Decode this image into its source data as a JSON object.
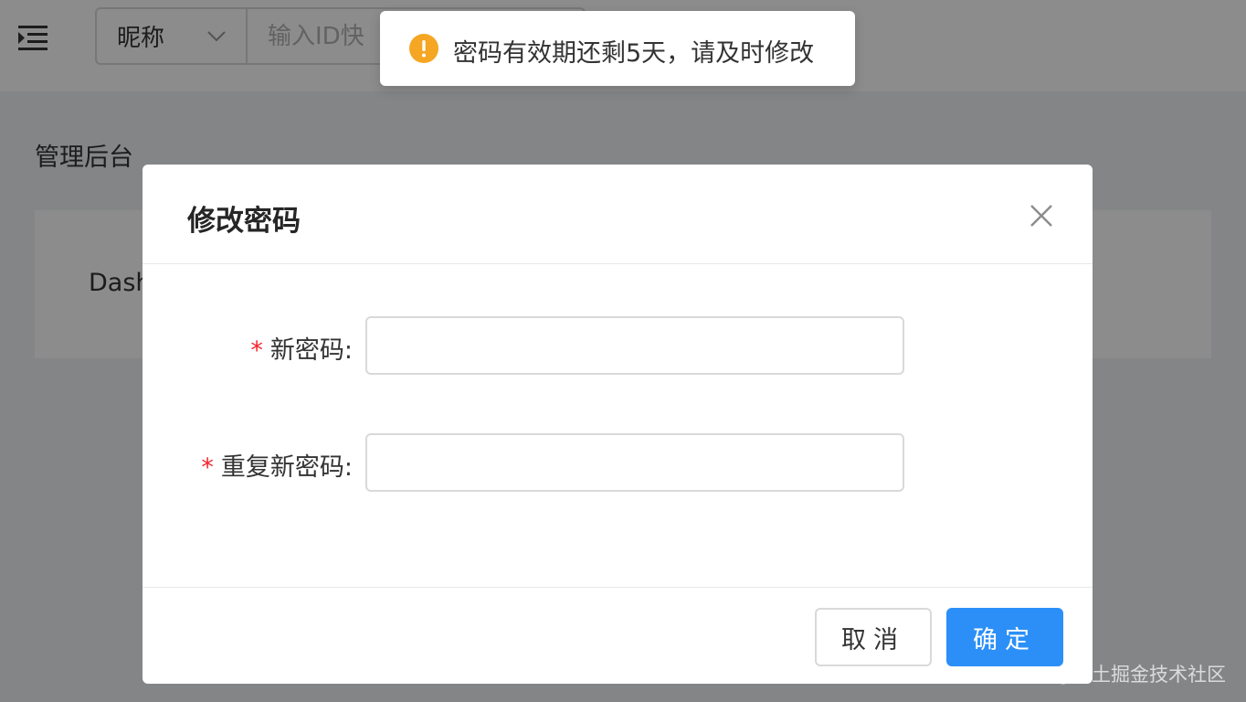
{
  "header": {
    "search": {
      "select_label": "昵称",
      "placeholder": "输入ID快"
    }
  },
  "breadcrumb": "管理后台",
  "dashboard": {
    "title": "Dash"
  },
  "toast": {
    "icon": "warning-icon",
    "message": "密码有效期还剩5天，请及时修改",
    "color": "#f5a623"
  },
  "dialog": {
    "title": "修改密码",
    "fields": [
      {
        "label": "新密码",
        "value": ""
      },
      {
        "label": "重复新密码",
        "value": ""
      }
    ],
    "required_mark": "*",
    "colon": ":",
    "cancel_label": "取消",
    "ok_label": "确定",
    "primary_color": "#2b8ff7"
  },
  "watermark": "@稀土掘金技术社区"
}
